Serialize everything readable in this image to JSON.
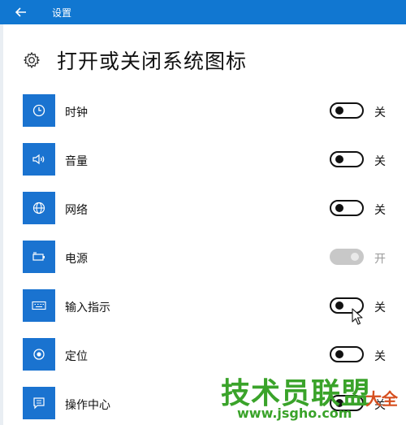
{
  "window": {
    "title": "设置"
  },
  "page": {
    "title": "打开或关闭系统图标"
  },
  "items": [
    {
      "label": "时钟",
      "state": "关",
      "on": false,
      "enabled": true,
      "icon": "clock-icon"
    },
    {
      "label": "音量",
      "state": "关",
      "on": false,
      "enabled": true,
      "icon": "volume-icon"
    },
    {
      "label": "网络",
      "state": "关",
      "on": false,
      "enabled": true,
      "icon": "network-globe-icon"
    },
    {
      "label": "电源",
      "state": "开",
      "on": true,
      "enabled": false,
      "icon": "battery-icon"
    },
    {
      "label": "输入指示",
      "state": "关",
      "on": false,
      "enabled": true,
      "icon": "keyboard-icon"
    },
    {
      "label": "定位",
      "state": "关",
      "on": false,
      "enabled": true,
      "icon": "location-icon"
    },
    {
      "label": "操作中心",
      "state": "关",
      "on": false,
      "enabled": true,
      "icon": "action-center-icon"
    }
  ],
  "watermark": {
    "main": "技术员联盟",
    "url": "www.jsgho.com",
    "tail": "大全"
  },
  "colors": {
    "accent": "#1177d1",
    "tile": "#1a73d0",
    "text": "#111111",
    "disabled": "#c8c8c8"
  }
}
